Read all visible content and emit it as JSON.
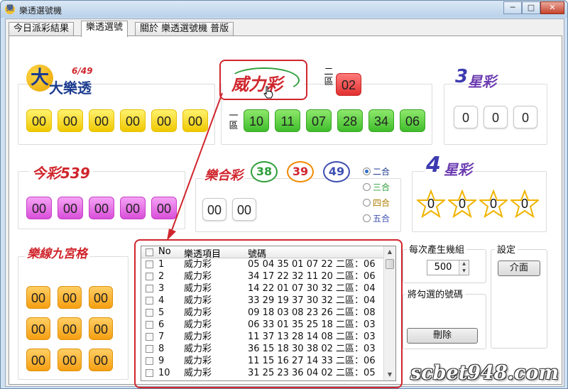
{
  "window": {
    "title": "樂透選號機",
    "buttons": {
      "minimize": "─",
      "maximize": "□",
      "close": "✕"
    }
  },
  "tabs": [
    {
      "label": "今日派彩結果"
    },
    {
      "label": "樂透選號"
    },
    {
      "label": "關於 樂透選號機 普版"
    }
  ],
  "lotto649": {
    "logo": "大樂透",
    "logo_sub": "6/49",
    "numbers": [
      "00",
      "00",
      "00",
      "00",
      "00",
      "00"
    ]
  },
  "superlotto": {
    "logo": "威力彩",
    "zone2_label": "二區",
    "zone2_number": "02",
    "zone1_label": "一區",
    "zone1_numbers": [
      "10",
      "11",
      "07",
      "28",
      "34",
      "06"
    ]
  },
  "star3": {
    "logo": "星彩",
    "logo_num": "3",
    "numbers": [
      "0",
      "0",
      "0"
    ]
  },
  "daily539": {
    "logo": "今彩539",
    "numbers": [
      "00",
      "00",
      "00",
      "00",
      "00"
    ]
  },
  "lotto_combo": {
    "logo": "樂合彩",
    "badges": [
      "38",
      "39",
      "49"
    ],
    "numbers": [
      "00",
      "00"
    ],
    "options": [
      "二合",
      "三合",
      "四合",
      "五合"
    ],
    "selected": "二合"
  },
  "star4": {
    "logo": "星彩",
    "logo_num": "4",
    "numbers": [
      "0",
      "0",
      "0",
      "0"
    ]
  },
  "bingo_grid": {
    "logo": "樂線九宮格",
    "numbers": [
      "00",
      "00",
      "00",
      "00",
      "00",
      "00",
      "00",
      "00",
      "00"
    ]
  },
  "results_list": {
    "headers": {
      "no": "No",
      "item": "樂透項目",
      "numbers": "號碼"
    },
    "rows": [
      {
        "no": "1",
        "item": "威力彩",
        "numbers": "05 04 35 01 07 22 二區：06"
      },
      {
        "no": "2",
        "item": "威力彩",
        "numbers": "34 17 22 32 11 20 二區：06"
      },
      {
        "no": "3",
        "item": "威力彩",
        "numbers": "14 22 01 07 30 32 二區：04"
      },
      {
        "no": "4",
        "item": "威力彩",
        "numbers": "33 29 19 37 30 32 二區：04"
      },
      {
        "no": "5",
        "item": "威力彩",
        "numbers": "09 18 03 08 23 26 二區：08"
      },
      {
        "no": "6",
        "item": "威力彩",
        "numbers": "06 33 01 35 25 18 二區：03"
      },
      {
        "no": "7",
        "item": "威力彩",
        "numbers": "11 37 13 28 14 08 二區：03"
      },
      {
        "no": "8",
        "item": "威力彩",
        "numbers": "36 15 18 30 38 02 二區：03"
      },
      {
        "no": "9",
        "item": "威力彩",
        "numbers": "11 15 16 27 14 33 二區：06"
      },
      {
        "no": "10",
        "item": "威力彩",
        "numbers": "31 25 23 36 04 02 二區：05"
      }
    ]
  },
  "per_generate": {
    "title": "每次產生幾組",
    "value": "500"
  },
  "delete_checked": {
    "title": "將勾選的號碼",
    "button": "刪除"
  },
  "settings": {
    "title": "設定",
    "button": "介面"
  },
  "watermark": "scbet948.com",
  "colors": {
    "highlight": "#d0262d",
    "yellow_ball": "#f5d411",
    "green_ball": "#4fc63a",
    "red_ball": "#e83b3b",
    "pink_ball": "#dd5ddd",
    "orange_ball": "#f7a823"
  }
}
